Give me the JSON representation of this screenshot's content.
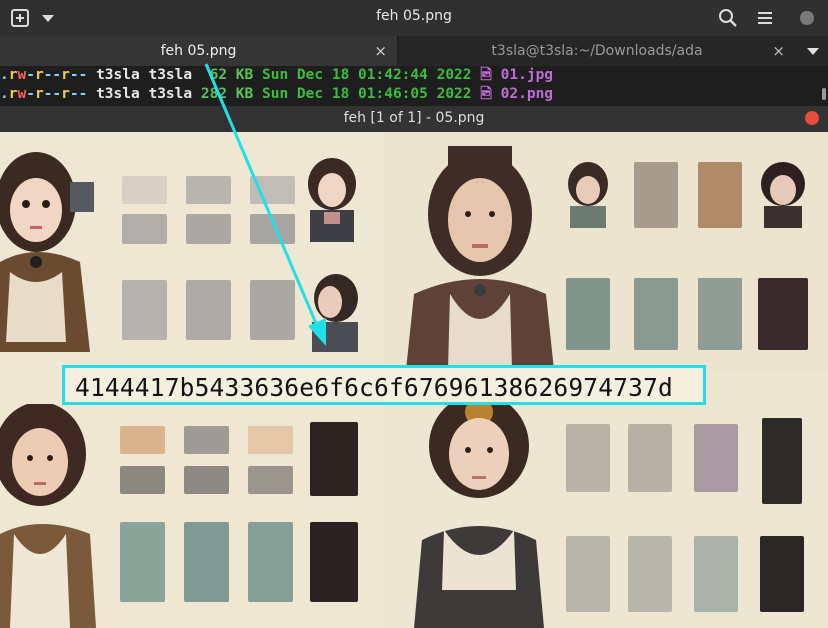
{
  "window": {
    "title": "feh 05.png",
    "icons": [
      "new-tab-icon",
      "chevron-down-icon",
      "search-icon",
      "hamburger-menu-icon",
      "window-dot-icon"
    ]
  },
  "tabs": [
    {
      "label": "feh 05.png",
      "active": true,
      "close": "×"
    },
    {
      "label": "t3sla@t3sla:~/Downloads/ada",
      "active": false,
      "close": "×"
    }
  ],
  "terminal": {
    "lines": [
      {
        "perm_dot": ".",
        "p1": "r",
        "p2": "w",
        "p3": "-",
        "p4": "r",
        "p5": "--",
        "p6": "r",
        "p7": "--",
        "user": "t3sla",
        "group": "t3sla",
        "size": "62",
        "unit": "KB",
        "date": "Sun Dec 18 01:42:44 2022",
        "file_icon": "🖻",
        "name": "01.jpg"
      },
      {
        "perm_dot": ".",
        "p1": "r",
        "p2": "w",
        "p3": "-",
        "p4": "r",
        "p5": "--",
        "p6": "r",
        "p7": "--",
        "user": "t3sla",
        "group": "t3sla",
        "size": "282",
        "unit": "KB",
        "date": "Sun Dec 18 01:46:05 2022",
        "file_icon": "🖻",
        "name": "02.png"
      }
    ]
  },
  "feh": {
    "title": "feh [1 of 1] - 05.png"
  },
  "annotation": {
    "hex": "4144417b5433636e6f6c6f676961386269747 37d",
    "hex_display": "4144417b5433636e6f6c6f67696138626974737d",
    "color": "#22e0ea"
  }
}
